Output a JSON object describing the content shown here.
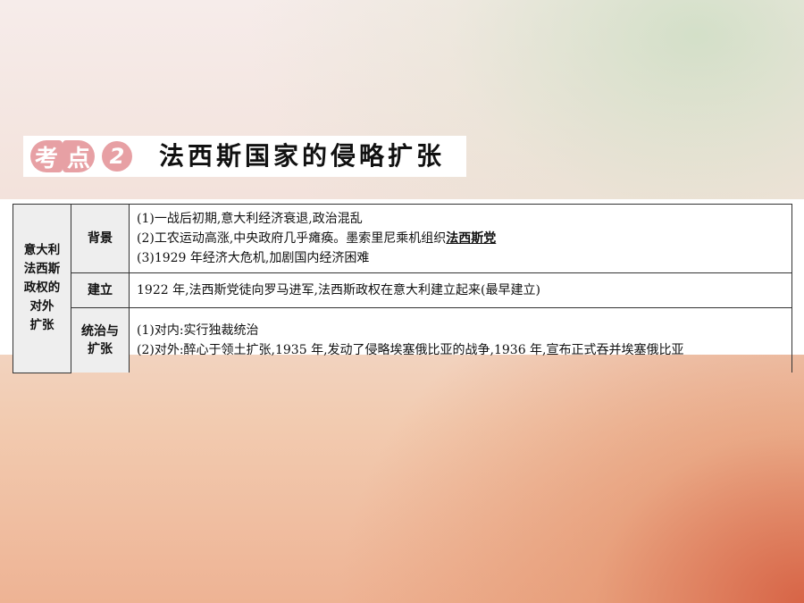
{
  "heading": {
    "badge_kao": "考",
    "badge_dian": "点",
    "badge_num": "2",
    "title": "法西斯国家的侵略扩张"
  },
  "table": {
    "topic_lines": [
      "意大利",
      "法西斯",
      "政权的",
      "对外",
      "扩张"
    ],
    "rows": [
      {
        "label_lines": [
          "背景"
        ],
        "lines": [
          {
            "text": "(1)一战后初期,意大利经济衰退,政治混乱"
          },
          {
            "text": "(2)工农运动高涨,中央政府几乎瘫痪。墨索里尼乘机组织",
            "term": "法西斯党"
          },
          {
            "text": "(3)1929 年经济大危机,加剧国内经济困难"
          }
        ]
      },
      {
        "label_lines": [
          "建立"
        ],
        "lines": [
          {
            "text": "1922 年,法西斯党徒向罗马进军,法西斯政权在意大利建立起来(最早建立)"
          }
        ]
      },
      {
        "label_lines": [
          "统治与",
          "扩张"
        ],
        "lines": [
          {
            "text": "(1)对内:实行独裁统治"
          },
          {
            "text": "(2)对外:醉心于领土扩张,1935 年,发动了侵略埃塞俄比亚的战争,1936 年,宣布正式吞并埃塞俄比亚"
          }
        ]
      }
    ]
  }
}
